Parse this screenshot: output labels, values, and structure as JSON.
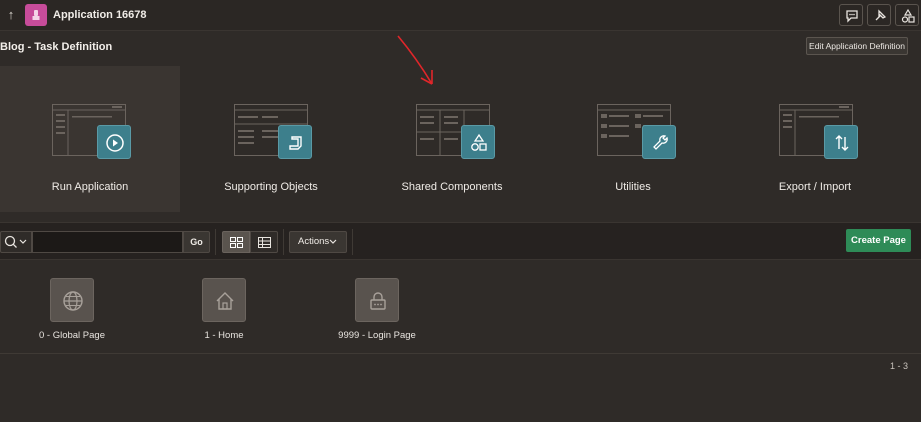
{
  "topbar": {
    "app_title": "Application 16678",
    "colors": {
      "app_icon": "#c74c9a"
    },
    "icons": [
      "up-arrow-icon",
      "comment-icon",
      "pin-icon",
      "shapes-icon"
    ]
  },
  "header": {
    "page_title": "Blog - Task Definition",
    "edit_button": "Edit Application Definition"
  },
  "tiles": [
    {
      "label": "Run Application",
      "icon": "play-icon"
    },
    {
      "label": "Supporting Objects",
      "icon": "scroll-icon"
    },
    {
      "label": "Shared Components",
      "icon": "shapes-icon"
    },
    {
      "label": "Utilities",
      "icon": "wrench-icon"
    },
    {
      "label": "Export / Import",
      "icon": "up-down-arrows-icon"
    }
  ],
  "toolbar": {
    "search_value": "",
    "go_label": "Go",
    "actions_label": "Actions",
    "create_page_label": "Create Page",
    "colors": {
      "create_button": "#2e8b57",
      "badge": "#3d7f8c"
    }
  },
  "pages": [
    {
      "label": "0 - Global Page",
      "icon": "globe-icon"
    },
    {
      "label": "1 - Home",
      "icon": "home-icon"
    },
    {
      "label": "9999 - Login Page",
      "icon": "lock-icon"
    }
  ],
  "pagination": {
    "range": "1 - 3"
  }
}
